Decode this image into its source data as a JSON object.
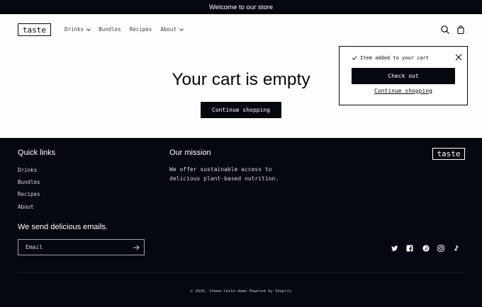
{
  "announcement": "Welcome to our store",
  "header": {
    "logo": "taste",
    "nav": [
      {
        "label": "Drinks",
        "dropdown": true
      },
      {
        "label": "Bundles",
        "dropdown": false
      },
      {
        "label": "Recipes",
        "dropdown": false
      },
      {
        "label": "About",
        "dropdown": true
      }
    ],
    "icons": [
      "search-icon",
      "cart-icon"
    ]
  },
  "main": {
    "title": "Your cart is empty",
    "continue_label": "Continue shopping"
  },
  "popup": {
    "message": "Item added to your cart",
    "checkout_label": "Check out",
    "continue_label": "Continue shopping"
  },
  "footer": {
    "quick_links_heading": "Quick links",
    "links": [
      "Drinks",
      "Bundles",
      "Recipes",
      "About"
    ],
    "mission_heading": "Our mission",
    "mission_line1": "We offer sustainable access to",
    "mission_line2": "delicious plant-based nutrition.",
    "logo": "taste",
    "newsletter_heading": "We send delicious emails.",
    "email_placeholder": "Email",
    "social": [
      "twitter-icon",
      "facebook-icon",
      "pinterest-icon",
      "instagram-icon",
      "tiktok-icon"
    ],
    "copyright": "© 2026, theme-taste-demo Powered by Shopify"
  },
  "colors": {
    "dark": "#05080f",
    "light": "#fdfdfd"
  }
}
